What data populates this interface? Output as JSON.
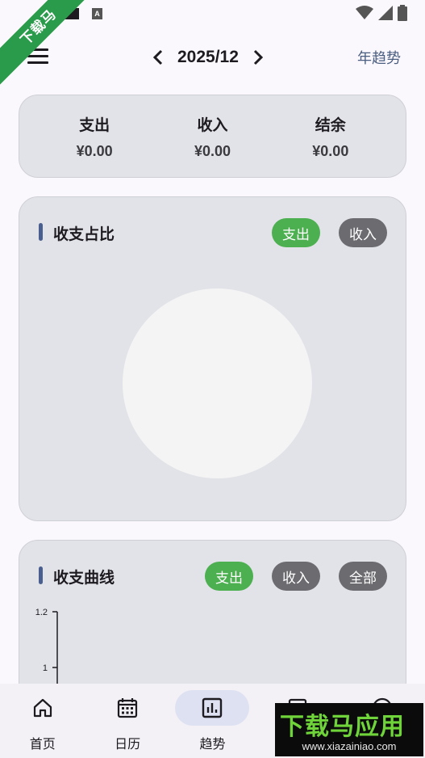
{
  "watermark": {
    "ribbon_text": "下载马",
    "box_main": "下载马应用",
    "box_url": "www.xiazainiao.com"
  },
  "status_bar": {
    "icons": [
      "app-icon",
      "a-icon",
      "wifi-icon",
      "signal-icon",
      "battery-icon"
    ]
  },
  "header": {
    "menu_icon": "menu-icon",
    "month": "2025/12",
    "year_trend_label": "年趋势"
  },
  "summary": {
    "expense_title": "支出",
    "expense_value": "¥0.00",
    "income_title": "收入",
    "income_value": "¥0.00",
    "balance_title": "结余",
    "balance_value": "¥0.00"
  },
  "pie_card": {
    "title": "收支占比",
    "chips": [
      "支出",
      "收入"
    ],
    "active_chip": "支出"
  },
  "line_card": {
    "title": "收支曲线",
    "chips": [
      "支出",
      "收入",
      "全部"
    ],
    "active_chip": "支出"
  },
  "chart_data": {
    "type": "line",
    "series": [],
    "y_ticks": [
      "1.2",
      "1"
    ],
    "ylim": [
      0,
      1.2
    ]
  },
  "bottom_nav": {
    "items": [
      {
        "label": "首页",
        "icon": "home-icon"
      },
      {
        "label": "日历",
        "icon": "calendar-icon"
      },
      {
        "label": "趋势",
        "icon": "bar-chart-icon"
      },
      {
        "label": "",
        "icon": "list-icon"
      },
      {
        "label": "",
        "icon": "profile-icon"
      }
    ],
    "active": "趋势"
  },
  "colors": {
    "accent_green": "#4caf50",
    "chip_inactive": "#6b6b70",
    "card_bg": "#e2e3e8",
    "accent_bar": "#4a5e8f",
    "nav_active_pill": "#dde1f2"
  }
}
